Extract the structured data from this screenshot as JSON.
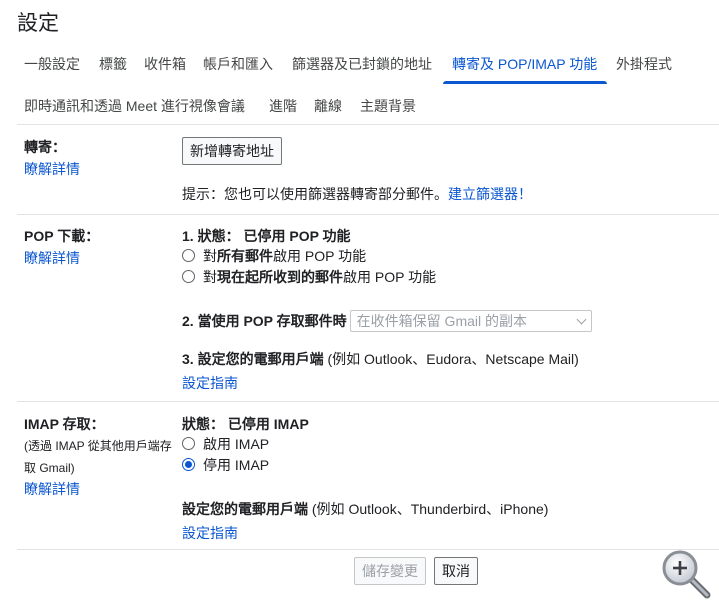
{
  "page_title": "設定",
  "tabs_row1": [
    {
      "label": "一般設定"
    },
    {
      "label": "標籤"
    },
    {
      "label": "收件箱"
    },
    {
      "label": "帳戶和匯入"
    },
    {
      "label": "篩選器及已封鎖的地址"
    },
    {
      "label": "轉寄及 POP/IMAP 功能",
      "active": true
    },
    {
      "label": "外掛程式"
    }
  ],
  "tabs_row2": [
    {
      "label": "即時通訊和透過 Meet 進行視像會議"
    },
    {
      "label": "進階"
    },
    {
      "label": "離線"
    },
    {
      "label": "主題背景"
    }
  ],
  "forwarding": {
    "title": "轉寄：",
    "learn_more": "瞭解詳情",
    "add_button": "新增轉寄地址",
    "tip": "提示：您也可以使用篩選器轉寄部分郵件。",
    "create_filter": "建立篩選器！"
  },
  "pop": {
    "title": "POP 下載：",
    "learn_more": "瞭解詳情",
    "status_prefix": "1. 狀態：",
    "status_value": "已停用 POP 功能",
    "option1_pre": "對",
    "option1_bold": "所有郵件",
    "option1_post": "啟用 POP 功能",
    "option2_pre": "對",
    "option2_bold": "現在起所收到的郵件",
    "option2_post": "啟用 POP 功能",
    "access_label": "2. 當使用 POP 存取郵件時",
    "access_select": "在收件箱保留 Gmail 的副本",
    "client_bold": "3. 設定您的電郵用戶端",
    "client_rest": " (例如 Outlook、Eudora、Netscape Mail)",
    "guide": "設定指南"
  },
  "imap": {
    "title": "IMAP 存取：",
    "subtitle_line1": "(透過 IMAP 從其他用戶端存",
    "subtitle_line2": "取 Gmail)",
    "learn_more": "瞭解詳情",
    "status_prefix": "狀態：",
    "status_value": "已停用 IMAP",
    "enable": "啟用 IMAP",
    "disable": "停用 IMAP",
    "client_bold": "設定您的電郵用戶端",
    "client_rest": " (例如 Outlook、Thunderbird、iPhone)",
    "guide": "設定指南"
  },
  "footer": {
    "save": "儲存變更",
    "cancel": "取消"
  },
  "colors": {
    "accent": "#0b57d0",
    "text": "#202124",
    "divider": "#e3e3e3"
  },
  "icons": [
    "magnifier-zoom-in-icon"
  ]
}
